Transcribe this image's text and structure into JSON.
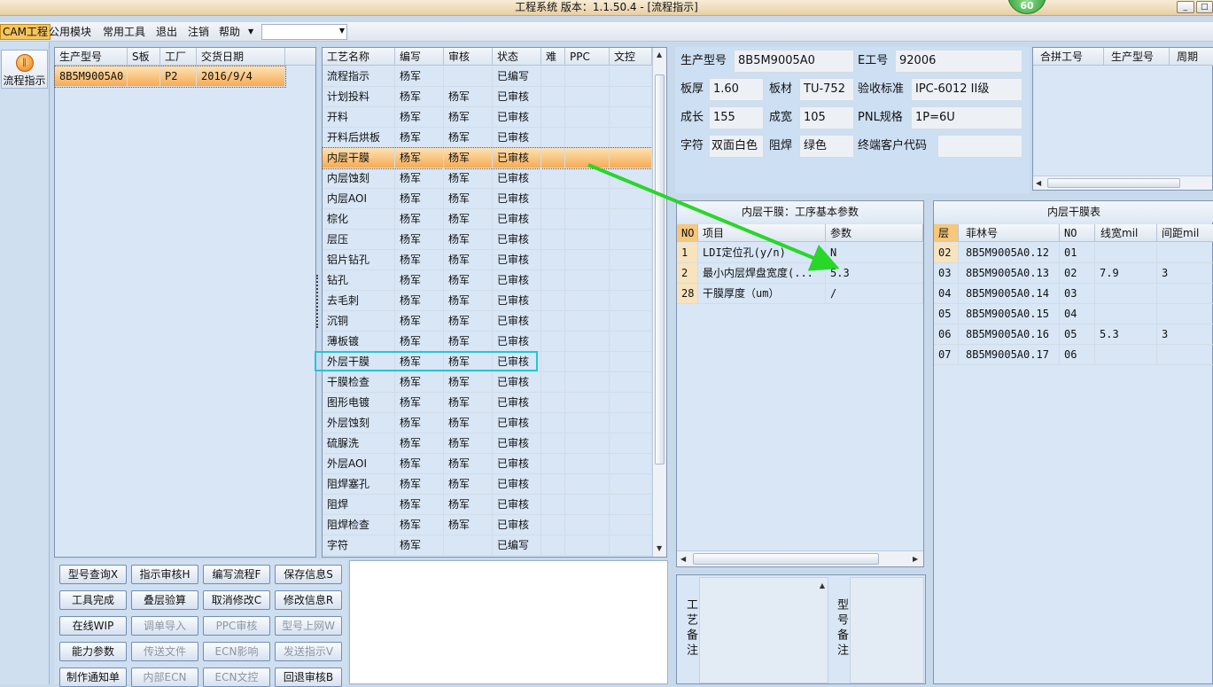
{
  "window": {
    "title": "工程系统  版本：1.1.50.4 - [流程指示]",
    "badge": "60",
    "min": "_",
    "max": "□"
  },
  "menu": {
    "items": [
      "CAM工程",
      "公用模块",
      "常用工具",
      "退出",
      "注销",
      "帮助"
    ],
    "combo_value": ""
  },
  "leftbar": {
    "flow_label": "流程指示"
  },
  "orders": {
    "headers": [
      "生产型号",
      "S板",
      "工厂",
      "交货日期"
    ],
    "rows": [
      {
        "model": "8B5M9005A0",
        "s": "",
        "factory": "P2",
        "date": "2016/9/4"
      }
    ]
  },
  "processes": {
    "headers": [
      "工艺名称",
      "编写",
      "审核",
      "状态",
      "难",
      "PPC",
      "文控"
    ],
    "rows": [
      {
        "name": "流程指示",
        "writer": "杨军",
        "auditor": "",
        "status": "已编写"
      },
      {
        "name": "计划投料",
        "writer": "杨军",
        "auditor": "杨军",
        "status": "已审核"
      },
      {
        "name": "开料",
        "writer": "杨军",
        "auditor": "杨军",
        "status": "已审核"
      },
      {
        "name": "开料后烘板",
        "writer": "杨军",
        "auditor": "杨军",
        "status": "已审核"
      },
      {
        "name": "内层干膜",
        "writer": "杨军",
        "auditor": "杨军",
        "status": "已审核"
      },
      {
        "name": "内层蚀刻",
        "writer": "杨军",
        "auditor": "杨军",
        "status": "已审核"
      },
      {
        "name": "内层AOI",
        "writer": "杨军",
        "auditor": "杨军",
        "status": "已审核"
      },
      {
        "name": "棕化",
        "writer": "杨军",
        "auditor": "杨军",
        "status": "已审核"
      },
      {
        "name": "层压",
        "writer": "杨军",
        "auditor": "杨军",
        "status": "已审核"
      },
      {
        "name": "铝片钻孔",
        "writer": "杨军",
        "auditor": "杨军",
        "status": "已审核"
      },
      {
        "name": "钻孔",
        "writer": "杨军",
        "auditor": "杨军",
        "status": "已审核"
      },
      {
        "name": "去毛刺",
        "writer": "杨军",
        "auditor": "杨军",
        "status": "已审核"
      },
      {
        "name": "沉铜",
        "writer": "杨军",
        "auditor": "杨军",
        "status": "已审核"
      },
      {
        "name": "薄板镀",
        "writer": "杨军",
        "auditor": "杨军",
        "status": "已审核"
      },
      {
        "name": "外层干膜",
        "writer": "杨军",
        "auditor": "杨军",
        "status": "已审核"
      },
      {
        "name": "干膜检查",
        "writer": "杨军",
        "auditor": "杨军",
        "status": "已审核"
      },
      {
        "name": "图形电镀",
        "writer": "杨军",
        "auditor": "杨军",
        "status": "已审核"
      },
      {
        "name": "外层蚀刻",
        "writer": "杨军",
        "auditor": "杨军",
        "status": "已审核"
      },
      {
        "name": "硫脲洗",
        "writer": "杨军",
        "auditor": "杨军",
        "status": "已审核"
      },
      {
        "name": "外层AOI",
        "writer": "杨军",
        "auditor": "杨军",
        "status": "已审核"
      },
      {
        "name": "阻焊塞孔",
        "writer": "杨军",
        "auditor": "杨军",
        "status": "已审核"
      },
      {
        "name": "阻焊",
        "writer": "杨军",
        "auditor": "杨军",
        "status": "已审核"
      },
      {
        "name": "阻焊检查",
        "writer": "杨军",
        "auditor": "杨军",
        "status": "已审核"
      },
      {
        "name": "字符",
        "writer": "杨军",
        "auditor": "",
        "status": "已编写"
      }
    ]
  },
  "info": {
    "model_label": "生产型号",
    "model": "8B5M9005A0",
    "e_label": "E工号",
    "e_no": "92006",
    "thick_label": "板厚",
    "thick": "1.60",
    "material_label": "板材",
    "material": "TU-752",
    "std_label": "验收标准",
    "std": "IPC-6012 II级",
    "len_label": "成长",
    "len": "155",
    "wid_label": "成宽",
    "wid": "105",
    "pnl_label": "PNL规格",
    "pnl": "1P=6U",
    "char_label": "字符",
    "char": "双面白色",
    "mask_label": "阻焊",
    "mask": "绿色",
    "cust_label": "终端客户代码",
    "cust": ""
  },
  "merge": {
    "headers": [
      "合拼工号",
      "生产型号",
      "周期"
    ]
  },
  "params": {
    "title": "内层干膜：工序基本参数",
    "headers": [
      "NO",
      "项目",
      "参数"
    ],
    "rows": [
      {
        "no": "1",
        "item": "LDI定位孔(y/n)",
        "val": "N"
      },
      {
        "no": "2",
        "item": "最小内层焊盘宽度(...",
        "val": "5.3"
      },
      {
        "no": "28",
        "item": "干膜厚度（um）",
        "val": "/"
      }
    ]
  },
  "film": {
    "title": "内层干膜表",
    "headers": [
      "层",
      "菲林号",
      "NO",
      "线宽mil",
      "间距mil"
    ],
    "rows": [
      {
        "layer": "02",
        "film": "8B5M9005A0.12",
        "no": "01",
        "width": "",
        "space": ""
      },
      {
        "layer": "03",
        "film": "8B5M9005A0.13",
        "no": "02",
        "width": "7.9",
        "space": "3"
      },
      {
        "layer": "04",
        "film": "8B5M9005A0.14",
        "no": "03",
        "width": "",
        "space": ""
      },
      {
        "layer": "05",
        "film": "8B5M9005A0.15",
        "no": "04",
        "width": "",
        "space": ""
      },
      {
        "layer": "06",
        "film": "8B5M9005A0.16",
        "no": "05",
        "width": "5.3",
        "space": "3"
      },
      {
        "layer": "07",
        "film": "8B5M9005A0.17",
        "no": "06",
        "width": "",
        "space": ""
      }
    ]
  },
  "buttons": [
    {
      "label": "型号查询X",
      "enabled": true
    },
    {
      "label": "指示审核H",
      "enabled": true
    },
    {
      "label": "编写流程F",
      "enabled": true
    },
    {
      "label": "保存信息S",
      "enabled": true
    },
    {
      "label": "工具完成",
      "enabled": true
    },
    {
      "label": "叠层验算",
      "enabled": true
    },
    {
      "label": "取消修改C",
      "enabled": true
    },
    {
      "label": "修改信息R",
      "enabled": true
    },
    {
      "label": "在线WIP",
      "enabled": true
    },
    {
      "label": "调单导入",
      "enabled": false
    },
    {
      "label": "PPC审核",
      "enabled": false
    },
    {
      "label": "型号上网W",
      "enabled": false
    },
    {
      "label": "能力参数",
      "enabled": true
    },
    {
      "label": "传送文件",
      "enabled": false
    },
    {
      "label": "ECN影响",
      "enabled": false
    },
    {
      "label": "发送指示V",
      "enabled": false
    },
    {
      "label": "制作通知单",
      "enabled": true
    },
    {
      "label": "内部ECN",
      "enabled": false
    },
    {
      "label": "ECN文控",
      "enabled": false
    },
    {
      "label": "回退审核B",
      "enabled": true
    }
  ],
  "memos": {
    "process_label": "工艺备注",
    "model_label": "型号备注"
  },
  "colors": {
    "selection": "#f6ab54",
    "highlight_box": "#22c6d9",
    "arrow": "#29d62a"
  }
}
